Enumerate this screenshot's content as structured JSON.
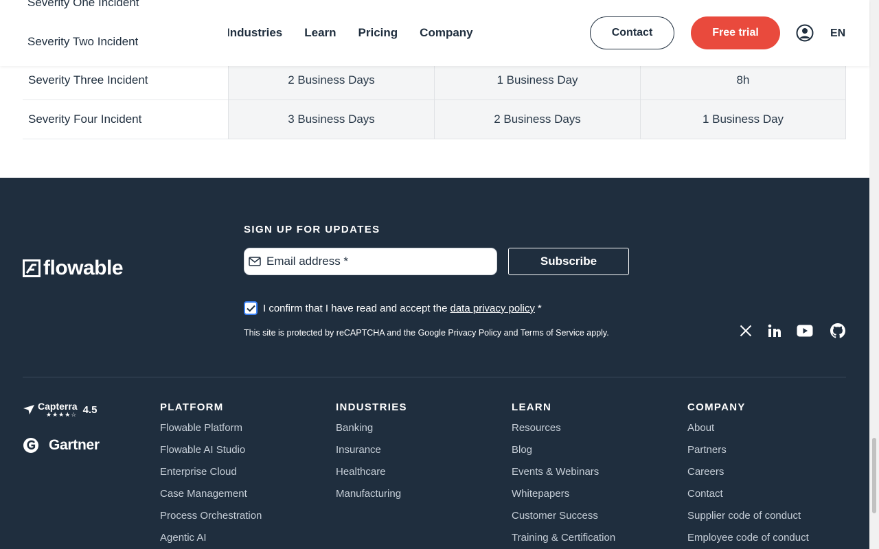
{
  "header": {
    "nav": [
      "Industries",
      "Learn",
      "Pricing",
      "Company"
    ],
    "contact_label": "Contact",
    "trial_label": "Free trial",
    "lang": "EN"
  },
  "dropdown": {
    "items": [
      "Severity One Incident",
      "Severity Two Incident"
    ]
  },
  "table": {
    "rows": [
      {
        "label": "Severity Three Incident",
        "cells": [
          "2 Business Days",
          "1 Business Day",
          "8h"
        ]
      },
      {
        "label": "Severity Four Incident",
        "cells": [
          "3 Business Days",
          "2 Business Days",
          "1 Business Day"
        ]
      }
    ]
  },
  "footer": {
    "logo_text": "flowable",
    "signup_title": "SIGN UP FOR UPDATES",
    "email_placeholder": "Email address *",
    "subscribe_label": "Subscribe",
    "consent_text": "I confirm that I have read and accept the",
    "consent_link": "data privacy policy",
    "consent_suffix": "*",
    "recaptcha_text": "This site is protected by reCAPTCHA and the Google Privacy Policy and Terms of Service apply.",
    "capterra_label": "Capterra",
    "capterra_stars": "★★★★☆",
    "capterra_score": "4.5",
    "gartner_label": "Gartner",
    "columns": [
      {
        "title": "PLATFORM",
        "links": [
          "Flowable Platform",
          "Flowable AI Studio",
          "Enterprise Cloud",
          "Case Management",
          "Process Orchestration",
          "Agentic AI"
        ]
      },
      {
        "title": "INDUSTRIES",
        "links": [
          "Banking",
          "Insurance",
          "Healthcare",
          "Manufacturing"
        ]
      },
      {
        "title": "LEARN",
        "links": [
          "Resources",
          "Blog",
          "Events & Webinars",
          "Whitepapers",
          "Customer Success",
          "Training & Certification"
        ]
      },
      {
        "title": "COMPANY",
        "links": [
          "About",
          "Partners",
          "Careers",
          "Contact",
          "Supplier code of conduct",
          "Employee code of conduct"
        ]
      }
    ]
  },
  "colors": {
    "accent": "#e94a3d",
    "footer_bg": "#1f2e3e",
    "text_dark": "#1e2d3d"
  },
  "icons": [
    "user-icon",
    "mail-icon",
    "check-icon",
    "x-twitter-icon",
    "linkedin-icon",
    "youtube-icon",
    "github-icon",
    "capterra-icon",
    "gartner-icon",
    "flowable-logo-icon"
  ]
}
